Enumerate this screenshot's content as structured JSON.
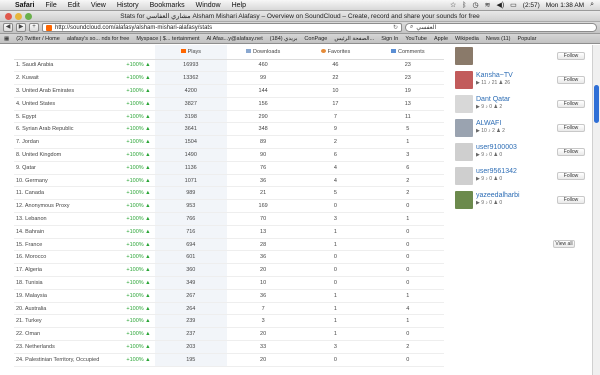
{
  "menubar": {
    "app": "Safari",
    "items": [
      "File",
      "Edit",
      "View",
      "History",
      "Bookmarks",
      "Window",
      "Help"
    ],
    "battery": "(2:57)",
    "clock": "Mon 1:38 AM"
  },
  "window": {
    "title": "Stats for مشاري العفاسي Alsham Mishari Alafasy – Overview on SoundCloud – Create, record and share your sounds for free"
  },
  "toolbar": {
    "url": "http://soundcloud.com/alafasy/alsham-mishari-alafasy/stats",
    "search_value": "العفسي"
  },
  "bookmarks": [
    "(2) Twitter / Home",
    "alafasy's so... nds for free",
    "Myspace | $... tertainment",
    "Al Afas...y@alafasy.net",
    "بريدي (184)",
    "ConPage",
    "الصفحة الرئيس...",
    "Sign In",
    "YouTube",
    "Apple",
    "Wikipedia",
    "News (11)",
    "Popular"
  ],
  "stats_table": {
    "headers": {
      "plays": "Plays",
      "downloads": "Downloads",
      "favorites": "Favorites",
      "comments": "Comments"
    },
    "rows": [
      {
        "country": "1. Saudi Arabia",
        "pct": "+100% ▲",
        "plays": "16993",
        "downloads": "460",
        "favorites": "46",
        "comments": "23"
      },
      {
        "country": "2. Kuwait",
        "pct": "+100% ▲",
        "plays": "13362",
        "downloads": "99",
        "favorites": "22",
        "comments": "23"
      },
      {
        "country": "3. United Arab Emirates",
        "pct": "+100% ▲",
        "plays": "4200",
        "downloads": "144",
        "favorites": "10",
        "comments": "19"
      },
      {
        "country": "4. United States",
        "pct": "+100% ▲",
        "plays": "3827",
        "downloads": "156",
        "favorites": "17",
        "comments": "13"
      },
      {
        "country": "5. Egypt",
        "pct": "+100% ▲",
        "plays": "3198",
        "downloads": "290",
        "favorites": "7",
        "comments": "11"
      },
      {
        "country": "6. Syrian Arab Republic",
        "pct": "+100% ▲",
        "plays": "3641",
        "downloads": "348",
        "favorites": "9",
        "comments": "5"
      },
      {
        "country": "7. Jordan",
        "pct": "+100% ▲",
        "plays": "1504",
        "downloads": "89",
        "favorites": "2",
        "comments": "1"
      },
      {
        "country": "8. United Kingdom",
        "pct": "+100% ▲",
        "plays": "1490",
        "downloads": "90",
        "favorites": "6",
        "comments": "3"
      },
      {
        "country": "9. Qatar",
        "pct": "+100% ▲",
        "plays": "1136",
        "downloads": "76",
        "favorites": "4",
        "comments": "6"
      },
      {
        "country": "10. Germany",
        "pct": "+100% ▲",
        "plays": "1071",
        "downloads": "36",
        "favorites": "4",
        "comments": "2"
      },
      {
        "country": "11. Canada",
        "pct": "+100% ▲",
        "plays": "989",
        "downloads": "21",
        "favorites": "5",
        "comments": "2"
      },
      {
        "country": "12. Anonymous Proxy",
        "pct": "+100% ▲",
        "plays": "953",
        "downloads": "169",
        "favorites": "0",
        "comments": "0"
      },
      {
        "country": "13. Lebanon",
        "pct": "+100% ▲",
        "plays": "766",
        "downloads": "70",
        "favorites": "3",
        "comments": "1"
      },
      {
        "country": "14. Bahrain",
        "pct": "+100% ▲",
        "plays": "716",
        "downloads": "13",
        "favorites": "1",
        "comments": "0"
      },
      {
        "country": "15. France",
        "pct": "+100% ▲",
        "plays": "694",
        "downloads": "28",
        "favorites": "1",
        "comments": "0"
      },
      {
        "country": "16. Morocco",
        "pct": "+100% ▲",
        "plays": "601",
        "downloads": "36",
        "favorites": "0",
        "comments": "0"
      },
      {
        "country": "17. Algeria",
        "pct": "+100% ▲",
        "plays": "360",
        "downloads": "20",
        "favorites": "0",
        "comments": "0"
      },
      {
        "country": "18. Tunisia",
        "pct": "+100% ▲",
        "plays": "349",
        "downloads": "10",
        "favorites": "0",
        "comments": "0"
      },
      {
        "country": "19. Malaysia",
        "pct": "+100% ▲",
        "plays": "267",
        "downloads": "36",
        "favorites": "1",
        "comments": "1"
      },
      {
        "country": "20. Australia",
        "pct": "+100% ▲",
        "plays": "264",
        "downloads": "7",
        "favorites": "1",
        "comments": "4"
      },
      {
        "country": "21. Turkey",
        "pct": "+100% ▲",
        "plays": "239",
        "downloads": "3",
        "favorites": "1",
        "comments": "1"
      },
      {
        "country": "22. Oman",
        "pct": "+100% ▲",
        "plays": "237",
        "downloads": "20",
        "favorites": "1",
        "comments": "0"
      },
      {
        "country": "23. Netherlands",
        "pct": "+100% ▲",
        "plays": "203",
        "downloads": "33",
        "favorites": "3",
        "comments": "2"
      },
      {
        "country": "24. Palestinian Territory, Occupied",
        "pct": "+100% ▲",
        "plays": "195",
        "downloads": "20",
        "favorites": "0",
        "comments": "0"
      }
    ]
  },
  "followers": {
    "follow_label": "Follow",
    "view_all": "View all",
    "items": [
      {
        "name": "",
        "stats": "",
        "avatar_color": "#8a7a6a"
      },
      {
        "name": "Kansha~TV",
        "stats": "▶ 11 ♪ 21 ♟ 26",
        "avatar_color": "#c25b5b"
      },
      {
        "name": "Dant Qatar",
        "stats": "▶ 9 ♪ 0 ♟ 2",
        "avatar_color": "#d8d8d8"
      },
      {
        "name": "ALWAFI",
        "stats": "▶ 10 ♪ 2 ♟ 2",
        "avatar_color": "#9aa3b0"
      },
      {
        "name": "user9100003",
        "stats": "▶ 9 ♪ 0 ♟ 0",
        "avatar_color": "#cfcfcf"
      },
      {
        "name": "user9561342",
        "stats": "▶ 9 ♪ 0 ♟ 0",
        "avatar_color": "#cfcfcf"
      },
      {
        "name": "yazeedalharbi",
        "stats": "▶ 9 ♪ 0 ♟ 0",
        "avatar_color": "#6c8a4d"
      }
    ]
  },
  "colors": {
    "accent": "#2d6db5",
    "positive": "#2aa536",
    "plays_col": "#f2f5f9",
    "scroll_thumb": "#2f6fd6"
  }
}
